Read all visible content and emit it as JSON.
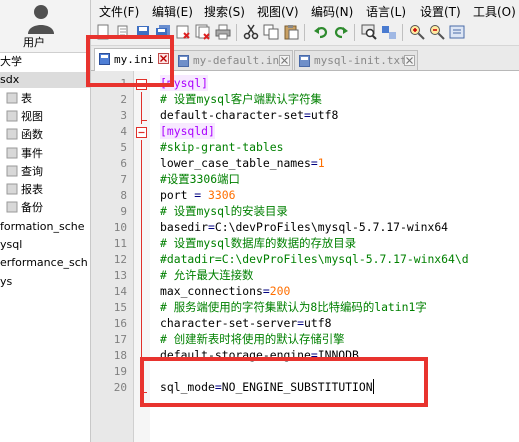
{
  "sidebar": {
    "user_label": "用户",
    "items": [
      {
        "label": "大学",
        "indent": 0
      },
      {
        "label": "sdx",
        "indent": 0
      },
      {
        "label": "表",
        "indent": 1
      },
      {
        "label": "视图",
        "indent": 1
      },
      {
        "label": "函数",
        "indent": 1
      },
      {
        "label": "事件",
        "indent": 1
      },
      {
        "label": "查询",
        "indent": 1
      },
      {
        "label": "报表",
        "indent": 1
      },
      {
        "label": "备份",
        "indent": 1
      },
      {
        "label": "formation_sche",
        "indent": 0
      },
      {
        "label": "ysql",
        "indent": 0
      },
      {
        "label": "erformance_sch",
        "indent": 0
      },
      {
        "label": "ys",
        "indent": 0
      }
    ]
  },
  "menu": [
    "文件(F)",
    "编辑(E)",
    "搜索(S)",
    "视图(V)",
    "编码(N)",
    "语言(L)",
    "设置(T)",
    "工具(O)"
  ],
  "tabs": [
    {
      "label": "my.ini",
      "active": true
    },
    {
      "label": "my-default.ini",
      "active": false
    },
    {
      "label": "mysql-init.txt",
      "active": false
    }
  ],
  "lines": [
    {
      "n": "1",
      "text": "[mysql]",
      "type": "section",
      "fold": true
    },
    {
      "n": "2",
      "text": "# 设置mysql客户端默认字符集",
      "type": "comment"
    },
    {
      "n": "3",
      "text": "default-character-set=utf8",
      "type": "kv"
    },
    {
      "n": "4",
      "text": "[mysqld]",
      "type": "section",
      "fold": true
    },
    {
      "n": "5",
      "text": "#skip-grant-tables",
      "type": "comment"
    },
    {
      "n": "6",
      "text": "lower_case_table_names=1",
      "type": "kv"
    },
    {
      "n": "7",
      "text": "#设置3306端口",
      "type": "comment"
    },
    {
      "n": "8",
      "text": "port = 3306",
      "type": "kv"
    },
    {
      "n": "9",
      "text": "# 设置mysql的安装目录",
      "type": "comment"
    },
    {
      "n": "10",
      "text": "basedir=C:\\devProFiles\\mysql-5.7.17-winx64",
      "type": "kv"
    },
    {
      "n": "11",
      "text": "# 设置mysql数据库的数据的存放目录",
      "type": "comment"
    },
    {
      "n": "12",
      "text": "#datadir=C:\\devProFiles\\mysql-5.7.17-winx64\\d",
      "type": "comment"
    },
    {
      "n": "13",
      "text": "# 允许最大连接数",
      "type": "comment"
    },
    {
      "n": "14",
      "text": "max_connections=200",
      "type": "kv"
    },
    {
      "n": "15",
      "text": "# 服务端使用的字符集默认为8比特编码的latin1字",
      "type": "comment"
    },
    {
      "n": "16",
      "text": "character-set-server=utf8",
      "type": "kv"
    },
    {
      "n": "17",
      "text": "# 创建新表时将使用的默认存储引擎",
      "type": "comment"
    },
    {
      "n": "18",
      "text": "default-storage-engine=INNODB",
      "type": "kv"
    },
    {
      "n": "19",
      "text": "",
      "type": "blank"
    },
    {
      "n": "20",
      "text": "sql_mode=NO_ENGINE_SUBSTITUTION",
      "type": "kv"
    }
  ]
}
